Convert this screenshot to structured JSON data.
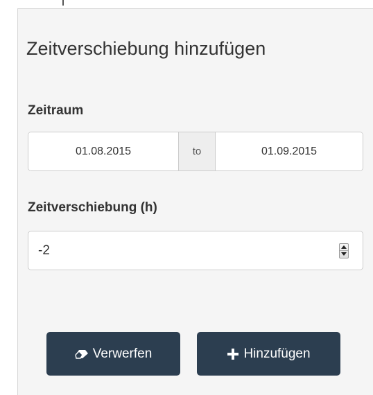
{
  "panel": {
    "title": "Zeitverschiebung hinzufügen"
  },
  "range": {
    "label": "Zeitraum",
    "from_value": "01.08.2015",
    "separator": "to",
    "to_value": "01.09.2015"
  },
  "shift": {
    "label": "Zeitverschiebung (h)",
    "value": "-2"
  },
  "buttons": {
    "discard_label": "Verwerfen",
    "discard_icon": "eraser-icon",
    "add_label": "Hinzufügen",
    "add_icon": "plus-icon"
  },
  "colors": {
    "button_bg": "#2c3e50",
    "panel_bg": "#f5f5f5"
  }
}
